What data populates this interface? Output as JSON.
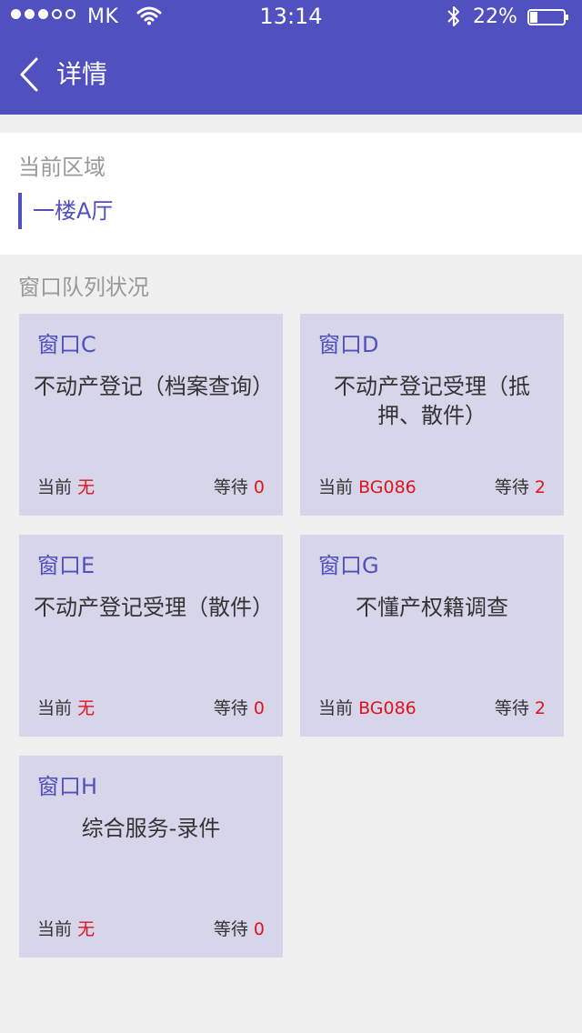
{
  "status": {
    "carrier": "MK",
    "time": "13:14",
    "battery_percent": "22%",
    "battery_level": 0.22
  },
  "nav": {
    "title": "详情"
  },
  "area": {
    "label": "当前区域",
    "value": "一楼A厅"
  },
  "queue": {
    "label": "窗口队列状况",
    "current_label": "当前",
    "wait_label": "等待",
    "windows": [
      {
        "name": "窗口C",
        "service": "不动产登记（档案查询）",
        "current": "无",
        "wait": "0"
      },
      {
        "name": "窗口D",
        "service": "不动产登记受理（抵押、散件）",
        "current": "BG086",
        "wait": "2"
      },
      {
        "name": "窗口E",
        "service": "不动产登记受理（散件）",
        "current": "无",
        "wait": "0"
      },
      {
        "name": "窗口G",
        "service": "不懂产权籍调查",
        "current": "BG086",
        "wait": "2"
      },
      {
        "name": "窗口H",
        "service": "综合服务-录件",
        "current": "无",
        "wait": "0"
      }
    ]
  },
  "colors": {
    "accent": "#5050bf",
    "card_bg": "#d7d5ea",
    "highlight": "#e0141e"
  },
  "icons": {
    "back": "chevron-left-icon",
    "wifi": "wifi-icon",
    "bluetooth": "bluetooth-icon",
    "battery": "battery-icon"
  }
}
